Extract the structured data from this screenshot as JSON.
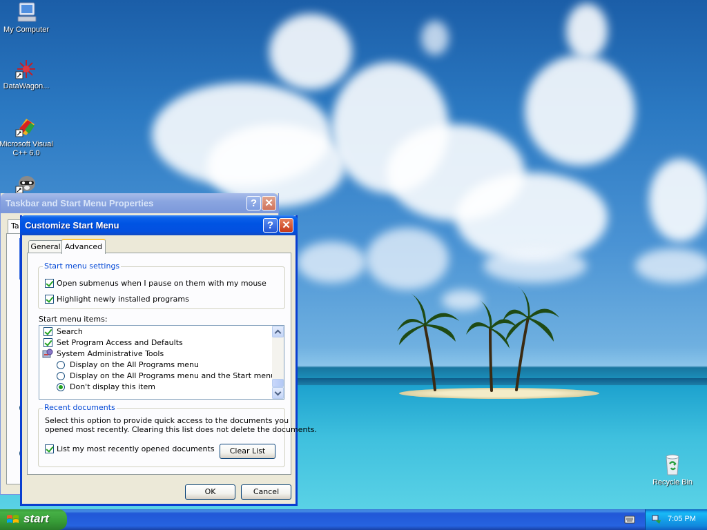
{
  "desktop": {
    "icons": [
      {
        "label": "My Computer",
        "icon": "my-computer-icon"
      },
      {
        "label": "DataWagon...",
        "icon": "datawagon-icon"
      },
      {
        "label": "Microsoft Visual C++ 6.0",
        "icon": "visual-cpp-icon"
      },
      {
        "label": "",
        "icon": "raccoon-app-icon"
      },
      {
        "label": "Recycle Bin",
        "icon": "recycle-bin-icon"
      }
    ]
  },
  "back_window": {
    "title": "Taskbar and Start Menu Properties",
    "tab_fragment": "Ta"
  },
  "dialog": {
    "title": "Customize Start Menu",
    "tabs": [
      {
        "label": "General",
        "active": false
      },
      {
        "label": "Advanced",
        "active": true
      }
    ],
    "start_menu_settings": {
      "legend": "Start menu settings",
      "options": [
        {
          "label": "Open submenus when I pause on them with my mouse",
          "checked": true
        },
        {
          "label": "Highlight newly installed programs",
          "checked": true
        }
      ]
    },
    "start_menu_items": {
      "label": "Start menu items:",
      "items": [
        {
          "type": "checkbox",
          "label": "Search",
          "checked": true
        },
        {
          "type": "checkbox",
          "label": "Set Program Access and Defaults",
          "checked": true
        },
        {
          "type": "heading",
          "label": "System Administrative Tools",
          "icon": "admin-tools-icon"
        },
        {
          "type": "radio",
          "label": "Display on the All Programs menu",
          "checked": false
        },
        {
          "type": "radio",
          "label": "Display on the All Programs menu and the Start menu",
          "checked": false
        },
        {
          "type": "radio",
          "label": "Don't display this item",
          "checked": true
        }
      ]
    },
    "recent_documents": {
      "legend": "Recent documents",
      "description_line1": "Select this option to provide quick access to the documents you",
      "description_line2": "opened most recently.  Clearing this list does not delete the documents.",
      "option_label": "List my most recently opened documents",
      "option_checked": true,
      "clear_button": "Clear List"
    },
    "ok_button": "OK",
    "cancel_button": "Cancel"
  },
  "taskbar": {
    "start_label": "start",
    "clock": "7:05 PM"
  },
  "colors": {
    "title_active": "#0054e3",
    "dialog_face": "#ece9d8",
    "group_legend": "#0046d5",
    "start_green": "#3c9b3c",
    "taskbar_blue": "#2663e0"
  }
}
